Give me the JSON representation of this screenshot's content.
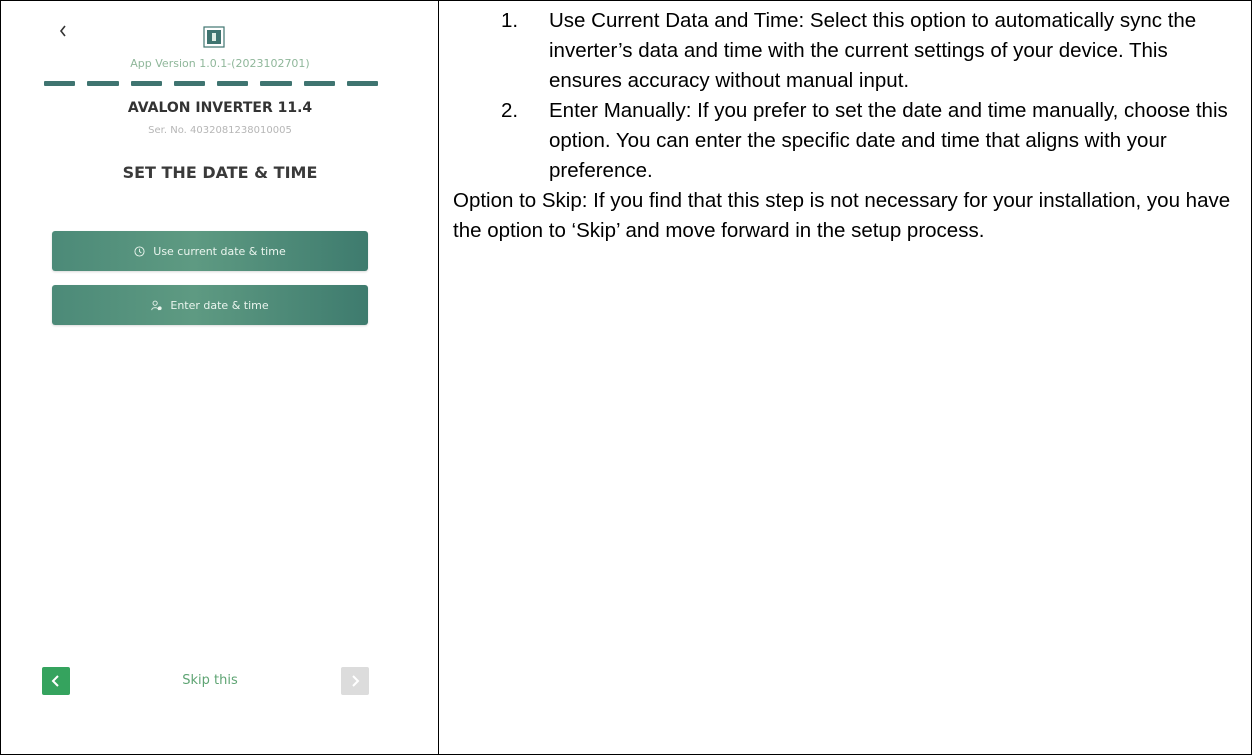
{
  "phone": {
    "app_version": "App Version 1.0.1-(2023102701)",
    "progress_steps": 8,
    "device_name": "AVALON INVERTER 11.4",
    "serial": "Ser. No. 4032081238010005",
    "title": "SET THE DATE & TIME",
    "buttons": [
      {
        "label": "Use current date & time",
        "icon": "clock-icon"
      },
      {
        "label": "Enter date & time",
        "icon": "user-settings-icon"
      }
    ],
    "skip_label": "Skip this",
    "colors": {
      "accent": "#4c8a78",
      "prev_button": "#35a35e",
      "next_button_disabled": "#dcdcdc",
      "progress": "#3f7470"
    }
  },
  "instructions": {
    "items": [
      {
        "num": "1.",
        "text": "Use Current Data and Time: Select this option to automatically sync the inverter’s data and time with the current settings of your device. This ensures accuracy without manual input."
      },
      {
        "num": "2.",
        "text": "Enter Manually: If you prefer to set the date and time manually, choose this option. You can enter the specific date and time that aligns with your preference."
      }
    ],
    "note": "Option to Skip: If you find that this step is not necessary for your installation, you have the option to ‘Skip’ and move forward in the setup process."
  }
}
